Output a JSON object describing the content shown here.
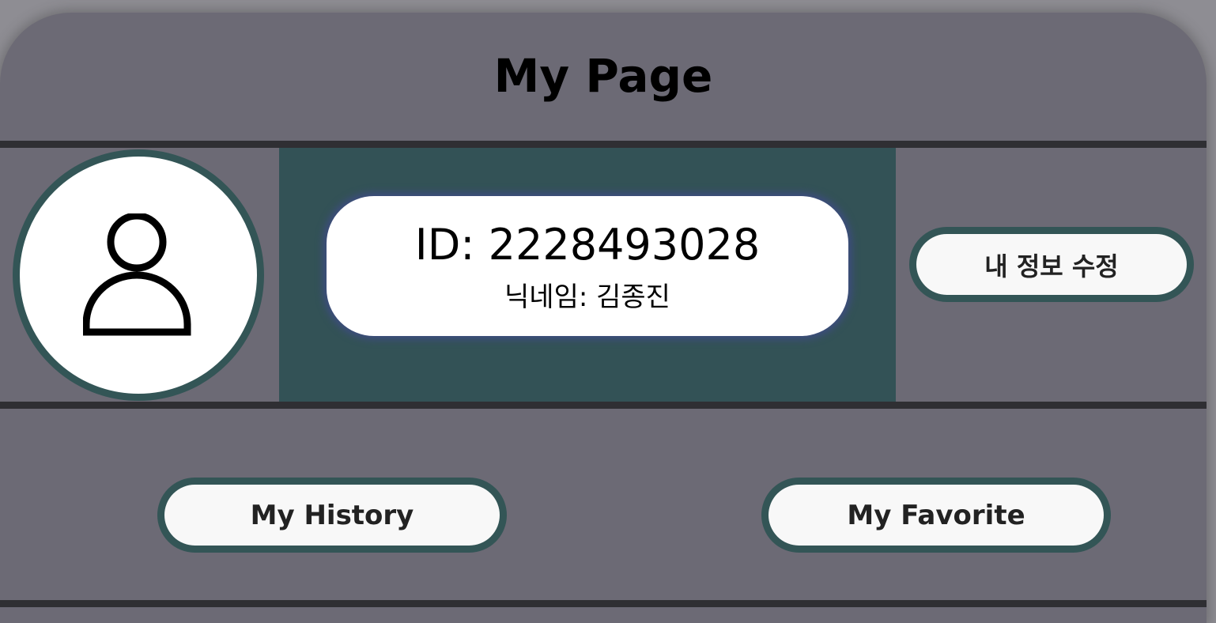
{
  "page": {
    "title": "My Page"
  },
  "profile": {
    "avatar_icon": "person-icon",
    "id_text": "ID: 2228493028",
    "nickname_text": "닉네임: 김종진"
  },
  "actions": {
    "edit_info_label": "내 정보 수정",
    "history_label": "My History",
    "favorite_label": "My Favorite"
  },
  "colors": {
    "panel_bg": "#6c6a75",
    "accent": "#335556",
    "info_area_bg": "#335256",
    "card_glow": "#3e4c82"
  }
}
